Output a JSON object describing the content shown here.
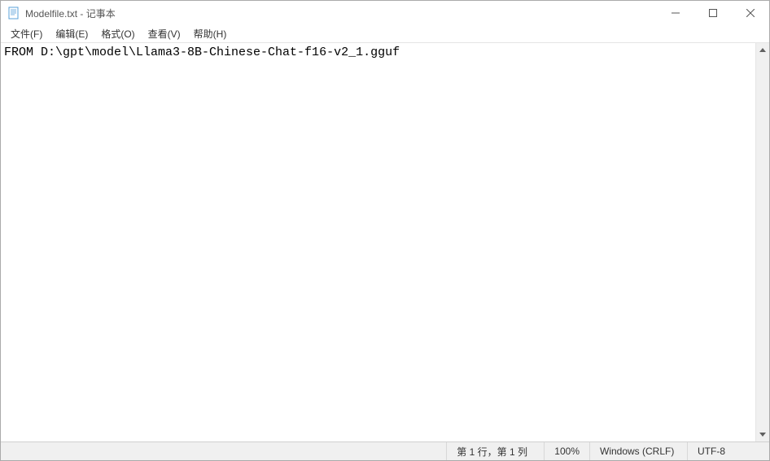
{
  "titlebar": {
    "title": "Modelfile.txt - 记事本"
  },
  "menu": {
    "file": "文件(F)",
    "edit": "编辑(E)",
    "format": "格式(O)",
    "view": "查看(V)",
    "help": "帮助(H)"
  },
  "editor": {
    "content": "FROM D:\\gpt\\model\\Llama3-8B-Chinese-Chat-f16-v2_1.gguf"
  },
  "status": {
    "position": "第 1 行，第 1 列",
    "zoom": "100%",
    "line_ending": "Windows (CRLF)",
    "encoding": "UTF-8"
  }
}
